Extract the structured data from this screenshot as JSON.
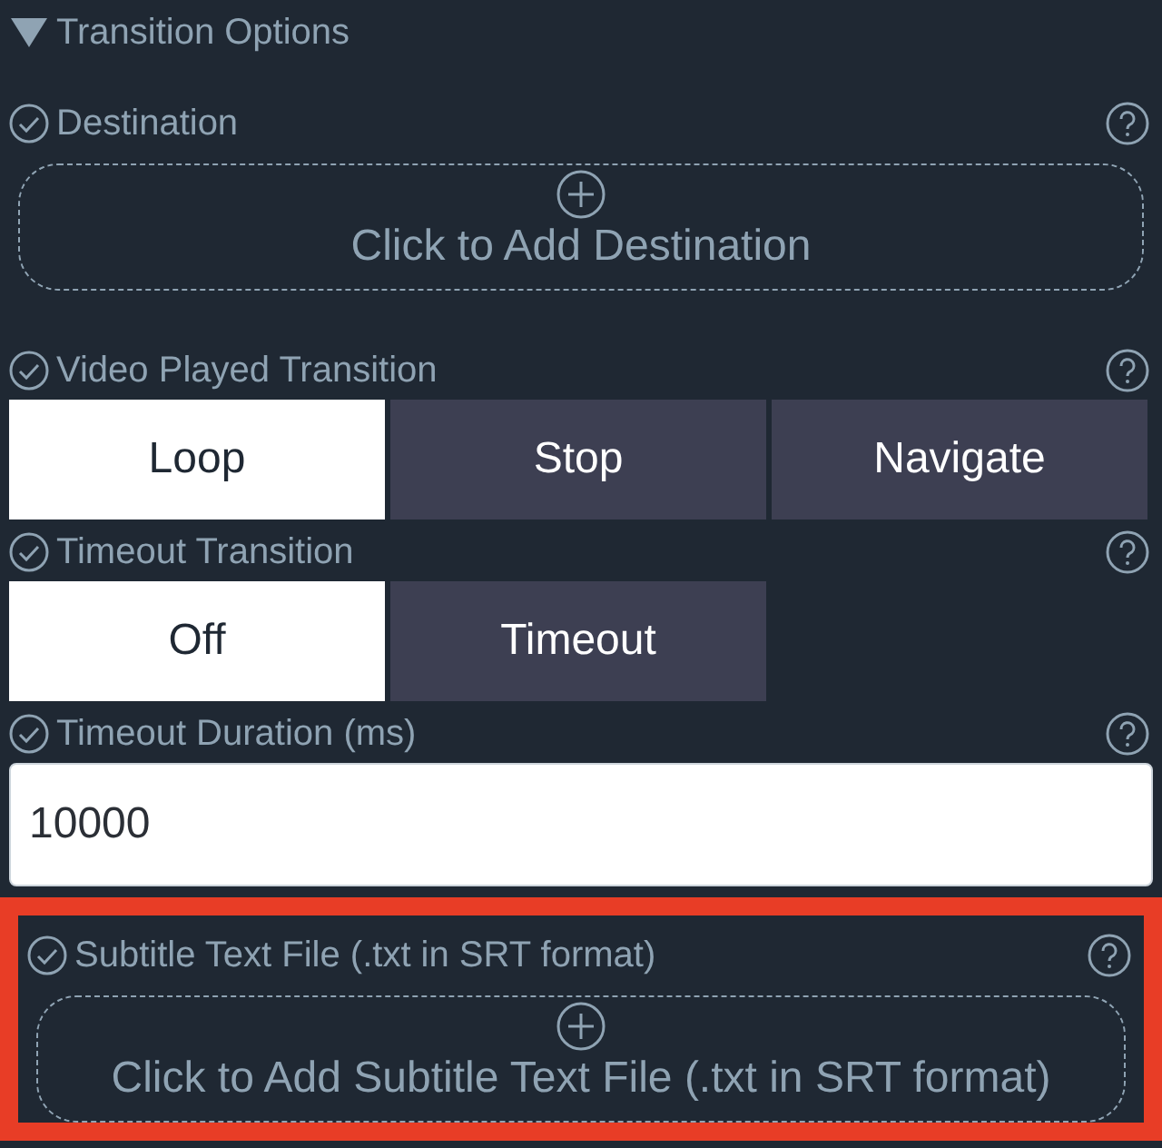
{
  "section": {
    "title": "Transition Options",
    "expanded": true
  },
  "fields": [
    {
      "kind": "dropzone",
      "label": "Destination",
      "action": "Click to Add Destination",
      "highlighted": false
    },
    {
      "kind": "segmented",
      "label": "Video Played Transition",
      "options": [
        {
          "label": "Loop",
          "selected": true
        },
        {
          "label": "Stop",
          "selected": false
        },
        {
          "label": "Navigate",
          "selected": false
        }
      ],
      "highlighted": false
    },
    {
      "kind": "segmented",
      "label": "Timeout Transition",
      "options": [
        {
          "label": "Off",
          "selected": true
        },
        {
          "label": "Timeout",
          "selected": false
        }
      ],
      "highlighted": false
    },
    {
      "kind": "input",
      "label": "Timeout Duration (ms)",
      "value": "10000",
      "highlighted": false
    },
    {
      "kind": "dropzone",
      "label": "Subtitle Text File (.txt in SRT format)",
      "action": "Click to Add Subtitle Text File (.txt in SRT format)",
      "highlighted": true
    }
  ]
}
